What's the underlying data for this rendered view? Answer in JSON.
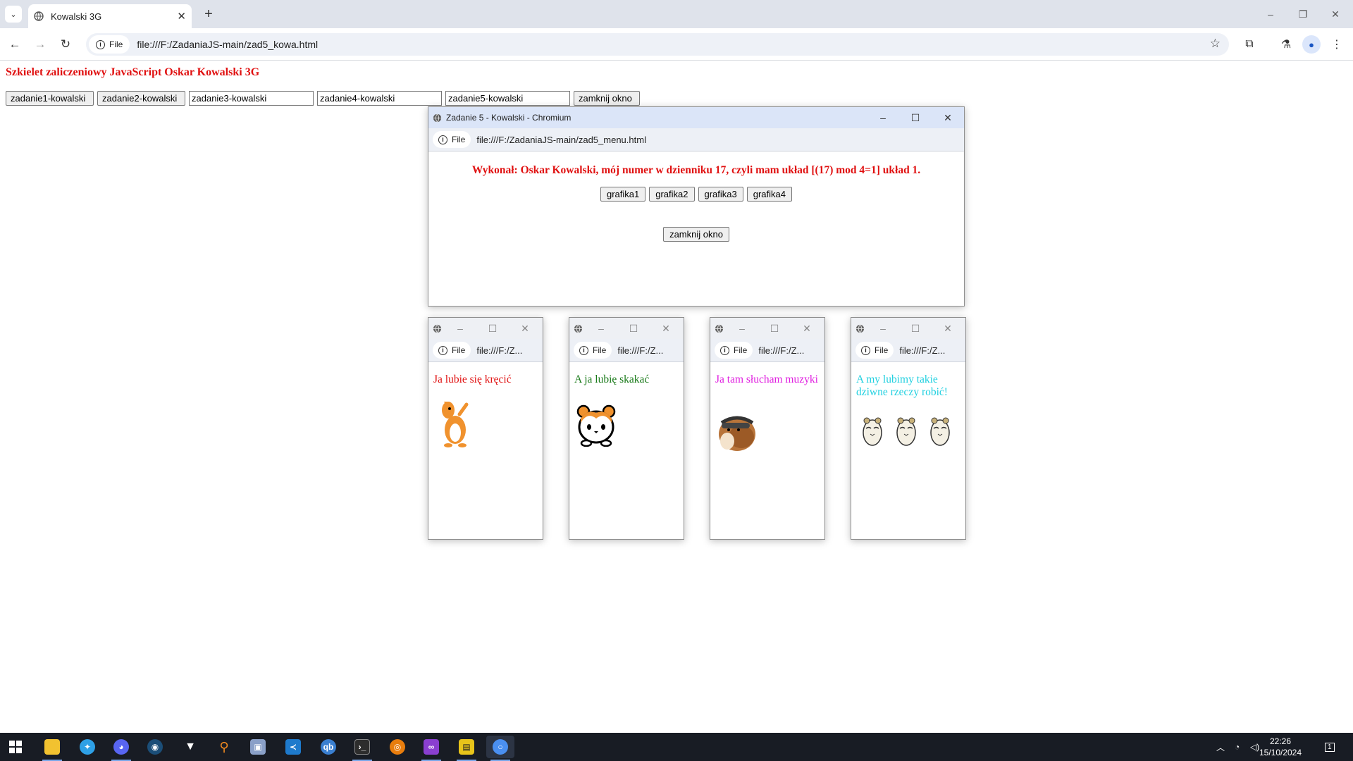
{
  "browser": {
    "tab_title": "Kowalski 3G",
    "tab_close": "✕",
    "new_tab": "+",
    "tab_menu": "⌄",
    "file_chip": "File",
    "url": "file:///F:/ZadaniaJS-main/zad5_kowa.html",
    "window_controls": [
      "–",
      "❐",
      "✕"
    ]
  },
  "page": {
    "header": "Szkielet zaliczeniowy JavaScript Oskar Kowalski 3G",
    "buttons": [
      "zadanie1-kowalski",
      "zadanie2-kowalski"
    ],
    "inputs": [
      "zadanie3-kowalski",
      "zadanie4-kowalski",
      "zadanie5-kowalski"
    ],
    "close_button": "zamknij okno"
  },
  "menu_popup": {
    "title": "Zadanie 5 - Kowalski - Chromium",
    "file_chip": "File",
    "url": "file:///F:/ZadaniaJS-main/zad5_menu.html",
    "heading": "Wykonał: Oskar Kowalski, mój numer w dzienniku 17, czyli mam układ [(17) mod 4=1] układ 1.",
    "grafika_buttons": [
      "grafika1",
      "grafika2",
      "grafika3",
      "grafika4"
    ],
    "close_button": "zamknij okno"
  },
  "small_popups": [
    {
      "file_chip": "File",
      "url": "file:///F:/Z...",
      "text": "Ja lubie się kręcić",
      "color": "#e01010",
      "picture": "dancing-hamster-image"
    },
    {
      "file_chip": "File",
      "url": "file:///F:/Z...",
      "text": "A ja lubię skakać",
      "color": "#1a7a1a",
      "picture": "hamster-face-image"
    },
    {
      "file_chip": "File",
      "url": "file:///F:/Z...",
      "text": "Ja tam słucham muzyki",
      "color": "#e020e0",
      "picture": "hamster-headphones-image"
    },
    {
      "file_chip": "File",
      "url": "file:///F:/Z...",
      "text": "A my lubimy takie dziwne rzeczy robić!",
      "color": "#20d0e0",
      "picture": "three-hamsters-image"
    }
  ],
  "taskbar": {
    "clock_time": "22:26",
    "clock_date": "15/10/2024",
    "notification_count": "1",
    "apps": [
      "start-icon",
      "file-explorer-icon",
      "app-bird-icon",
      "discord-icon",
      "steam-icon",
      "fox-app-icon",
      "search-app-icon",
      "image-app-icon",
      "vscode-icon",
      "qbittorrent-icon",
      "terminal-icon",
      "blender-icon",
      "mask-app-icon",
      "pdf-app-icon",
      "chromium-icon"
    ]
  }
}
